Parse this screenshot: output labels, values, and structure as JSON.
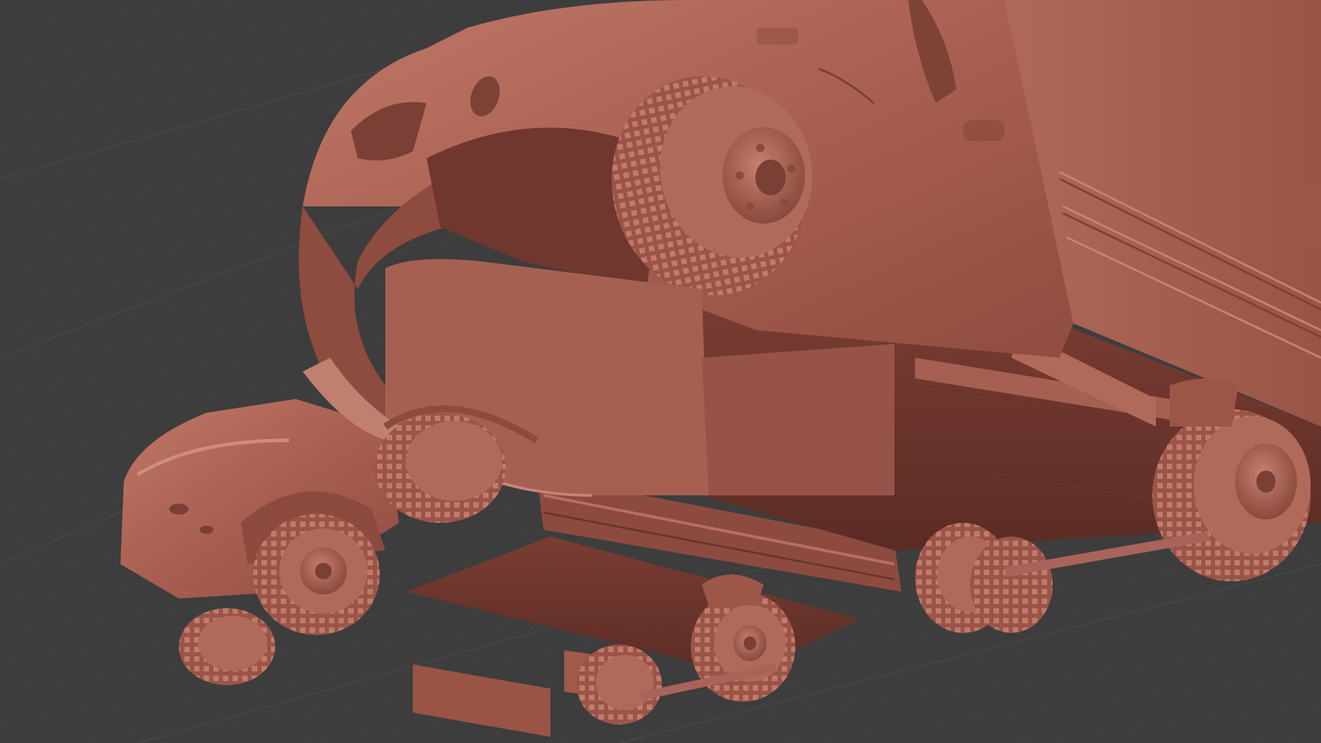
{
  "viewport": {
    "background": "#3d3d3d",
    "grid_color": "#4c4c4c",
    "grid_minor_color": "#444444"
  },
  "model": {
    "material_color": "#b26a5c",
    "shadow_color": "#5e3029",
    "highlight_color": "#d08c7c",
    "dark_color": "#7a3f35",
    "objects": [
      "truck-large-foreground",
      "truck-small-background"
    ]
  }
}
